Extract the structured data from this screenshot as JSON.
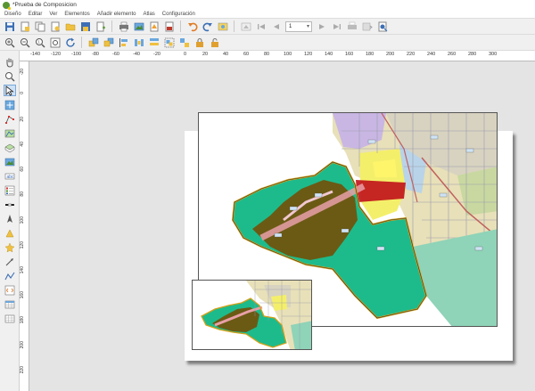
{
  "window": {
    "title": "*Prueba de Composicion"
  },
  "menubar": {
    "items": [
      "Diseño",
      "Editar",
      "Ver",
      "Elementos",
      "Añadir elemento",
      "Atlas",
      "Configuración"
    ]
  },
  "toolbar": {
    "atlas_page_value": "1"
  },
  "rulers": {
    "horizontal_labels": [
      "-140",
      "-120",
      "-100",
      "-80",
      "-60",
      "-40",
      "-20",
      "0",
      "20",
      "40",
      "60",
      "80",
      "100",
      "120",
      "140",
      "160",
      "180",
      "200",
      "220",
      "240",
      "260",
      "280",
      "300"
    ],
    "vertical_labels": [
      "-20",
      "0",
      "20",
      "40",
      "60",
      "80",
      "100",
      "120",
      "140",
      "160",
      "180",
      "200",
      "220"
    ]
  },
  "colors": {
    "qgis_green": "#589632",
    "qgis_yellow": "#eec90d",
    "map_green": "#1dbb8c",
    "map_olive": "#6b5a14",
    "map_teal": "#8fd3b8",
    "map_yellow": "#f4ef6a",
    "map_boundary": "#d4a017"
  }
}
